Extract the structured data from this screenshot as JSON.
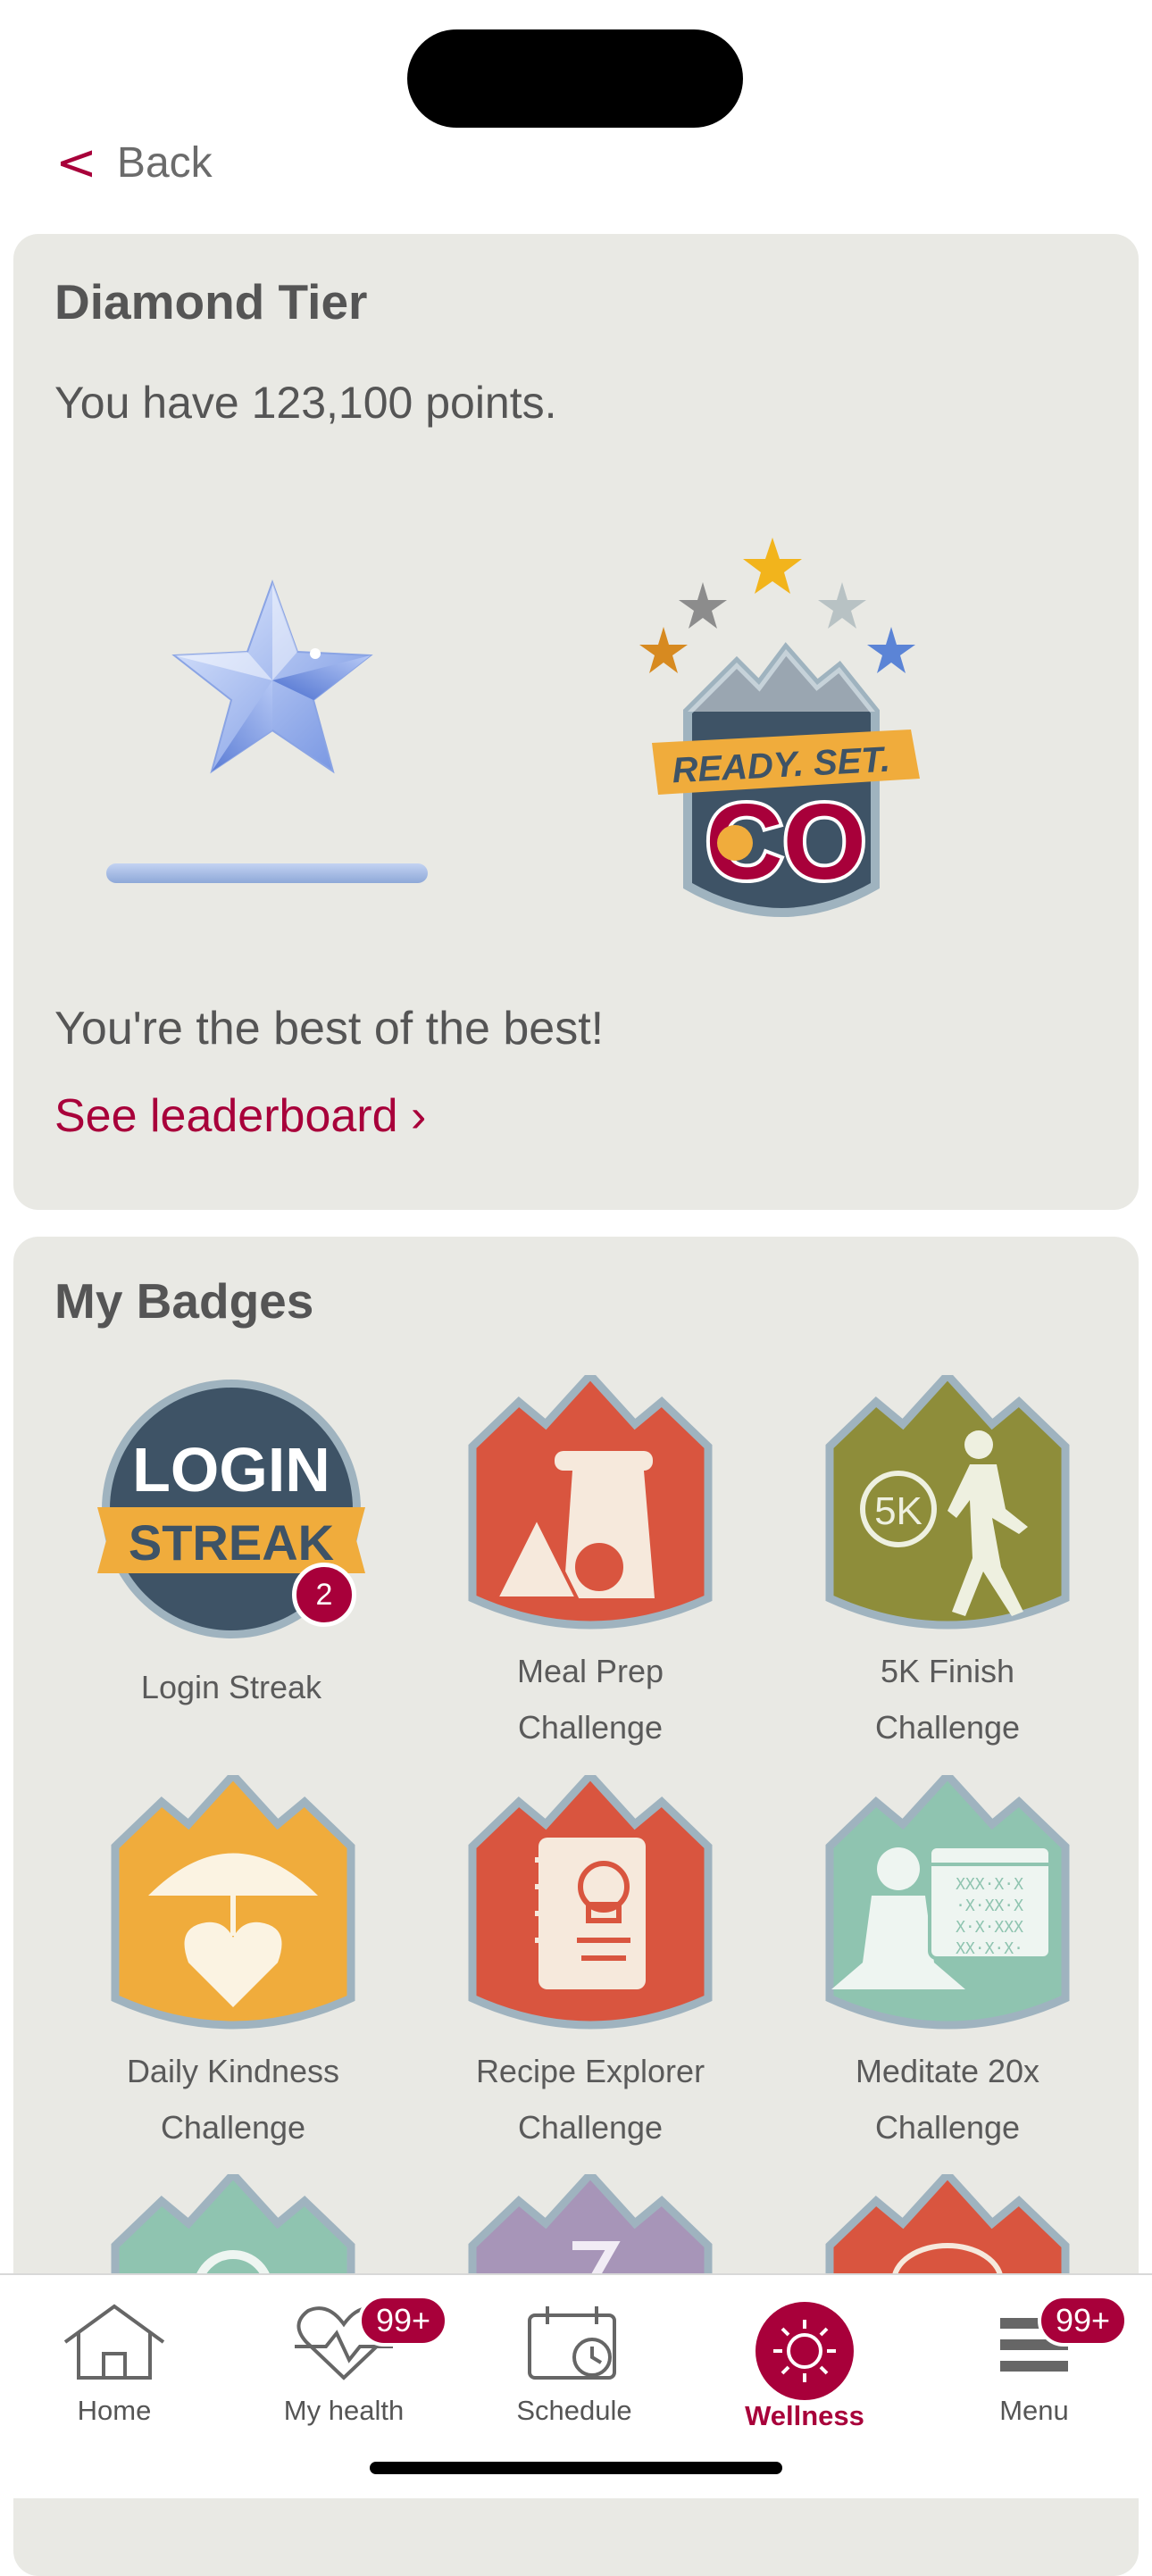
{
  "nav": {
    "back_label": "Back"
  },
  "tier": {
    "title": "Diamond Tier",
    "points_text": "You have 123,100 points.",
    "progress": 1.0,
    "badge_banner": "READY. SET.",
    "badge_letters": "CO",
    "message": "You're the best of the best!",
    "leaderboard_link": "See leaderboard ›"
  },
  "badges": {
    "title": "My Badges",
    "login_line1": "LOGIN",
    "login_line2": "STREAK",
    "login_count": "2",
    "meditate_pattern": [
      "XXX·X·X",
      "·X·XX·X",
      "X·X·XXX",
      "XX·X·X·"
    ],
    "run_label": "5K",
    "items": [
      {
        "label_line1": "Login Streak",
        "label_line2": "",
        "icon": "login-streak-badge-icon"
      },
      {
        "label_line1": "Meal Prep",
        "label_line2": "Challenge",
        "icon": "meal-prep-badge-icon",
        "color": "#d9553f"
      },
      {
        "label_line1": "5K Finish",
        "label_line2": "Challenge",
        "icon": "5k-finish-badge-icon",
        "color": "#8e8d3a"
      },
      {
        "label_line1": "Daily Kindness",
        "label_line2": "Challenge",
        "icon": "daily-kindness-badge-icon",
        "color": "#f0ac3c"
      },
      {
        "label_line1": "Recipe Explorer",
        "label_line2": "Challenge",
        "icon": "recipe-explorer-badge-icon",
        "color": "#d9553f"
      },
      {
        "label_line1": "Meditate 20x",
        "label_line2": "Challenge",
        "icon": "meditate-badge-icon",
        "color": "#8fc4b0"
      }
    ]
  },
  "tabbar": {
    "tabs": [
      {
        "label": "Home",
        "icon": "home-icon"
      },
      {
        "label": "My health",
        "icon": "heart-icon",
        "badge": "99+"
      },
      {
        "label": "Schedule",
        "icon": "calendar-clock-icon"
      },
      {
        "label": "Wellness",
        "icon": "sun-icon",
        "active": true
      },
      {
        "label": "Menu",
        "icon": "menu-icon",
        "badge": "99+"
      }
    ]
  },
  "colors": {
    "accent": "#a8003a",
    "card_bg": "#e9e9e4",
    "text": "#555555",
    "badge_navy": "#3e5366",
    "badge_gold": "#f0ac3c"
  }
}
